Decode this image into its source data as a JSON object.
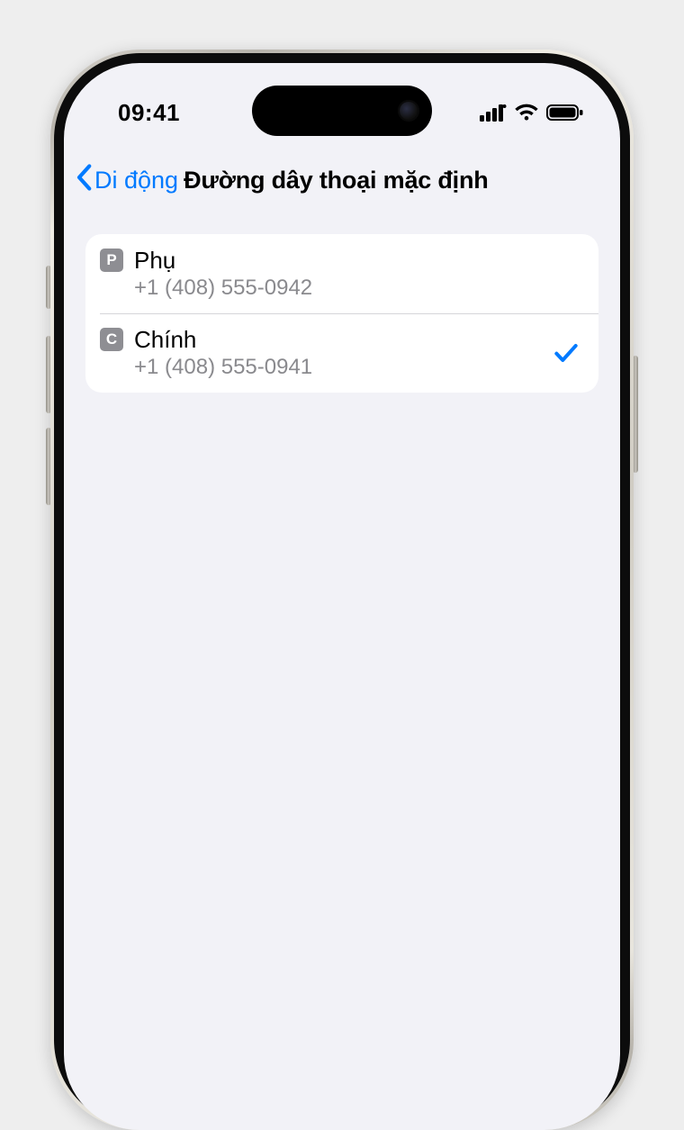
{
  "statusBar": {
    "time": "09:41"
  },
  "nav": {
    "backLabel": "Di động",
    "title": "Đường dây thoại mặc định"
  },
  "lines": [
    {
      "badge": "P",
      "label": "Phụ",
      "number": "+1 (408) 555-0942",
      "selected": false
    },
    {
      "badge": "C",
      "label": "Chính",
      "number": "+1 (408) 555-0941",
      "selected": true
    }
  ]
}
